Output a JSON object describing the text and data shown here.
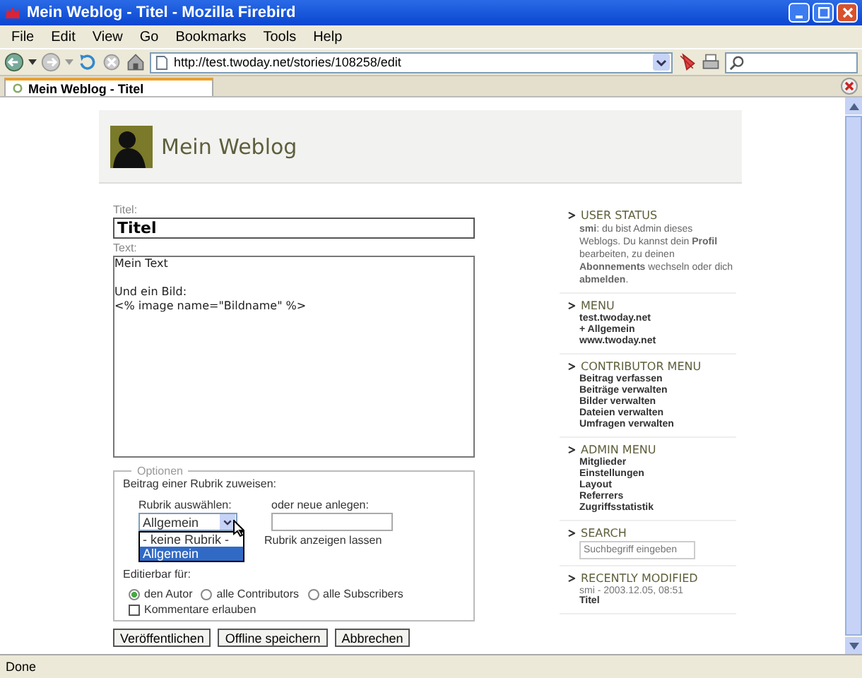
{
  "window": {
    "title": "Mein Weblog - Titel - Mozilla Firebird"
  },
  "menu": [
    "File",
    "Edit",
    "View",
    "Go",
    "Bookmarks",
    "Tools",
    "Help"
  ],
  "address": {
    "value": "http://test.twoday.net/stories/108258/edit"
  },
  "tabs": [
    {
      "label": "Mein Weblog - Titel",
      "selected": true
    }
  ],
  "blog": {
    "name": "Mein Weblog"
  },
  "form": {
    "title_label": "Titel:",
    "title_value": "Titel",
    "text_label": "Text:",
    "text_paragraphs": [
      "Mein Text",
      "Und ein Bild:\n<% image name=\"Bildname\" %>"
    ],
    "options": {
      "legend": "Optionen",
      "assign_label": "Beitrag einer Rubrik zuweisen:",
      "choose_label": "Rubrik auswählen:",
      "new_label": "oder neue anlegen:",
      "select_value": "Allgemein",
      "dropdown": [
        {
          "label": "- keine Rubrik -",
          "selected": false
        },
        {
          "label": "Allgemein",
          "selected": true
        }
      ],
      "show_label": "Rubrik anzeigen lassen",
      "editable_label": "Editierbar für:",
      "radios": [
        {
          "label": "den Autor",
          "selected": true
        },
        {
          "label": "alle Contributors",
          "selected": false
        },
        {
          "label": "alle Subscribers",
          "selected": false
        }
      ],
      "comments": {
        "label": "Kommentare erlauben",
        "checked": false
      }
    },
    "buttons": [
      "Veröffentlichen",
      "Offline speichern",
      "Abbrechen"
    ]
  },
  "sidebar": [
    {
      "kind": "text",
      "title": "USER STATUS",
      "text": "**smi**: du bist Admin dieses Weblogs. Du kannst dein **Profil** bearbeiten, zu deinen **Abonnements** wechseln oder dich **abmelden**."
    },
    {
      "kind": "links",
      "title": "MENU",
      "items": [
        "test.twoday.net",
        "+ Allgemein",
        "www.twoday.net"
      ]
    },
    {
      "kind": "links",
      "title": "CONTRIBUTOR MENU",
      "items": [
        "Beitrag verfassen",
        "Beiträge verwalten",
        "Bilder verwalten",
        "Dateien verwalten",
        "Umfragen verwalten"
      ]
    },
    {
      "kind": "links",
      "title": "ADMIN MENU",
      "items": [
        "Mitglieder",
        "Einstellungen",
        "Layout",
        "Referrers",
        "Zugriffsstatistik"
      ]
    },
    {
      "kind": "search",
      "title": "SEARCH",
      "placeholder": "Suchbegriff eingeben"
    },
    {
      "kind": "recent",
      "title": "RECENTLY MODIFIED",
      "meta": "smi - 2003.12.05, 08:51",
      "item": "Titel"
    }
  ],
  "status_bar": "Done"
}
